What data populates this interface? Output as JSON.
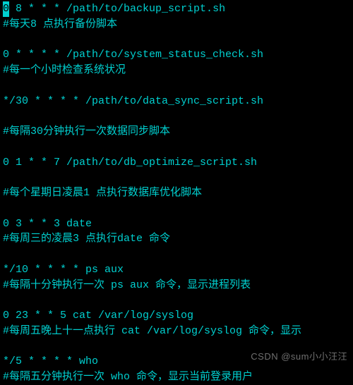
{
  "terminal": {
    "cursor_char": "0",
    "line1_rest": " 8 * * * /path/to/backup_script.sh",
    "line2": "#每天8 点执行备份脚本",
    "line3": "0 * * * * /path/to/system_status_check.sh",
    "line4": "#每一个小时检查系统状况",
    "line5": "*/30 * * * * /path/to/data_sync_script.sh",
    "line6": "#每隔30分钟执行一次数据同步脚本",
    "line7": "0 1 * * 7 /path/to/db_optimize_script.sh",
    "line8": "#每个星期日凌晨1 点执行数据库优化脚本",
    "line9": "0 3 * * 3 date",
    "line10": "#每周三的凌晨3 点执行date 命令",
    "line11": "*/10 * * * * ps aux",
    "line12": "#每隔十分钟执行一次 ps aux 命令，显示进程列表",
    "line13": "0 23 * * 5 cat /var/log/syslog",
    "line14": "#每周五晚上十一点执行 cat /var/log/syslog 命令，显示",
    "line15": "*/5 * * * * who",
    "line16": "#每隔五分钟执行一次 who 命令，显示当前登录用户"
  },
  "watermark": "CSDN @sum小小汪汪"
}
